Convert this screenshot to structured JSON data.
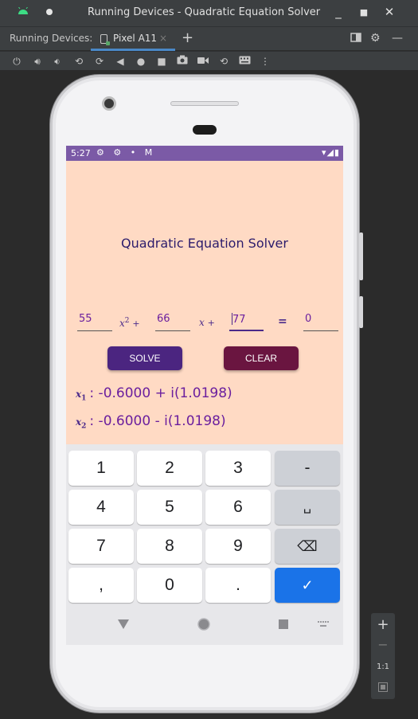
{
  "window": {
    "title": "Running Devices - Quadratic Equation Solver",
    "minimize": "_",
    "maximize": "■",
    "close": "✕"
  },
  "tabs": {
    "panel_label": "Running Devices:",
    "device_tab": "Pixel A11",
    "close_glyph": "×",
    "add_glyph": "+"
  },
  "toolbar": {
    "icons": [
      "power-icon",
      "volume-up-icon",
      "volume-down-icon",
      "rotate-left-icon",
      "rotate-right-icon",
      "back-icon",
      "home-icon",
      "overview-icon",
      "screenshot-icon",
      "screen-record-icon",
      "reset-icon",
      "keyboard-icon",
      "more-icon"
    ]
  },
  "status_bar": {
    "time": "5:27",
    "left_icons": "⚙ ⚙ • M",
    "right_icons": "▾◢▮"
  },
  "app": {
    "title": "Quadratic Equation Solver",
    "a_value": "55",
    "b_value": "66",
    "c_value": "77",
    "x2_term": "x",
    "x2_exp": "2",
    "x_term": "x",
    "plus": "+",
    "equals": "=",
    "rhs": "0",
    "solve_label": "SOLVE",
    "clear_label": "CLEAR",
    "root1_label": "x",
    "root1_sub": "1",
    "root1_value": ": -0.6000 + i(1.0198)",
    "root2_label": "x",
    "root2_sub": "2",
    "root2_value": ": -0.6000 - i(1.0198)"
  },
  "keyboard": {
    "rows": [
      [
        "1",
        "2",
        "3",
        "-"
      ],
      [
        "4",
        "5",
        "6",
        "␣"
      ],
      [
        "7",
        "8",
        "9",
        "⌫"
      ],
      [
        ",",
        "0",
        ".",
        "✓"
      ]
    ]
  },
  "zoom_panel": {
    "zoom_in": "+",
    "zoom_out": "−",
    "actual_size": "1:1"
  },
  "colors": {
    "app_background": "#ffdac4",
    "status_bar": "#7b5aa6",
    "solve_button": "#4b2580",
    "clear_button": "#6a1540",
    "accent_text": "#6b1f9e",
    "confirm_key": "#1a73e8"
  }
}
